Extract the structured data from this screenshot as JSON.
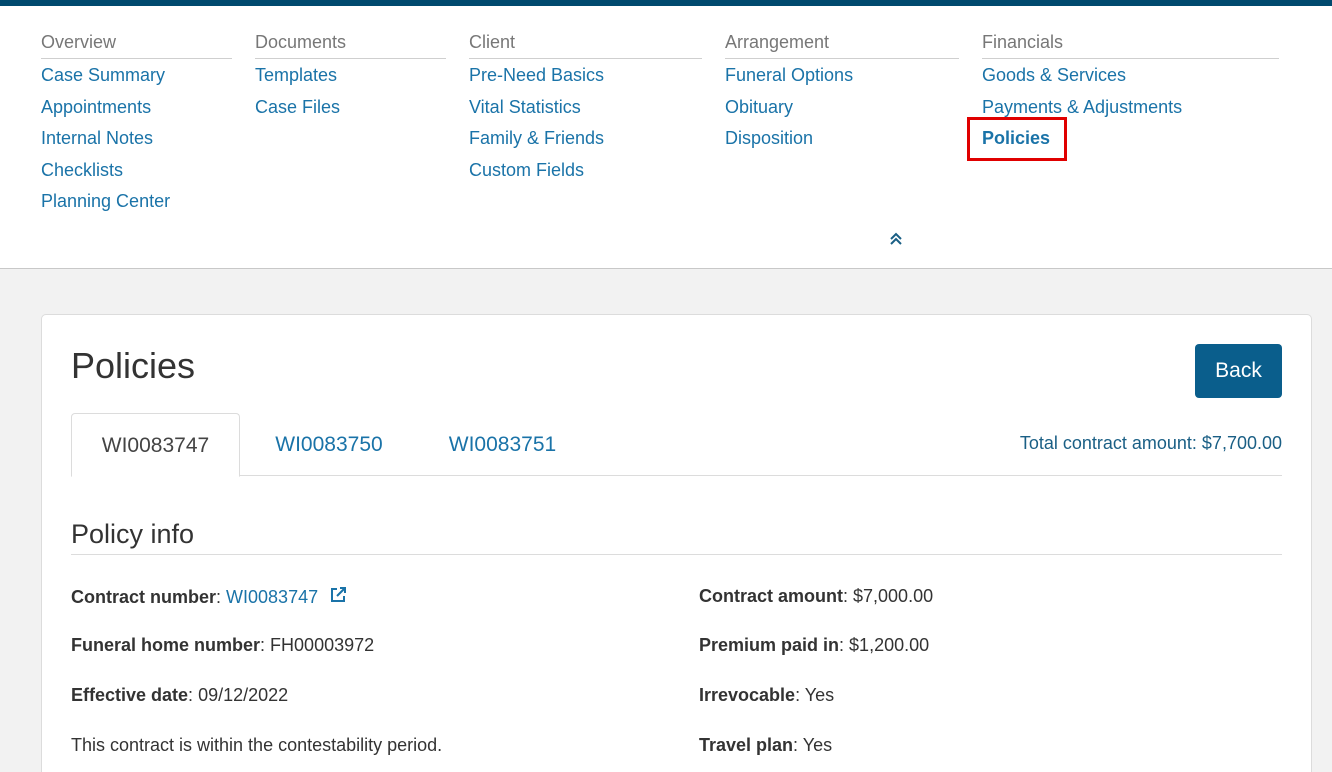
{
  "nav": {
    "columns": [
      {
        "heading": "Overview",
        "items": [
          "Case Summary",
          "Appointments",
          "Internal Notes",
          "Checklists",
          "Planning Center"
        ]
      },
      {
        "heading": "Documents",
        "items": [
          "Templates",
          "Case Files"
        ]
      },
      {
        "heading": "Client",
        "items": [
          "Pre-Need Basics",
          "Vital Statistics",
          "Family & Friends",
          "Custom Fields"
        ]
      },
      {
        "heading": "Arrangement",
        "items": [
          "Funeral Options",
          "Obituary",
          "Disposition"
        ]
      },
      {
        "heading": "Financials",
        "items": [
          "Goods & Services",
          "Payments & Adjustments",
          "Policies"
        ]
      }
    ],
    "collapse_icon": "double-chevron-up-icon"
  },
  "page": {
    "title": "Policies",
    "back_label": "Back",
    "tabs": [
      "WI0083747",
      "WI0083750",
      "WI0083751"
    ],
    "active_tab": 0,
    "total_contract": "Total contract amount: $7,700.00"
  },
  "policy": {
    "section_title": "Policy info",
    "contract_number_label": "Contract number",
    "contract_number": "WI0083747",
    "funeral_home_label": "Funeral home number",
    "funeral_home": "FH00003972",
    "effective_date_label": "Effective date",
    "effective_date": "09/12/2022",
    "contestability_note": "This contract is within the contestability period.",
    "contract_amount_label": "Contract amount",
    "contract_amount": "$7,000.00",
    "premium_label": "Premium paid in",
    "premium": "$1,200.00",
    "irrevocable_label": "Irrevocable",
    "irrevocable": "Yes",
    "travel_label": "Travel plan",
    "travel": "Yes"
  },
  "colors": {
    "accent": "#1a73a8",
    "button": "#0a5e8c",
    "topbar": "#004a6e",
    "highlight": "#e00000"
  }
}
